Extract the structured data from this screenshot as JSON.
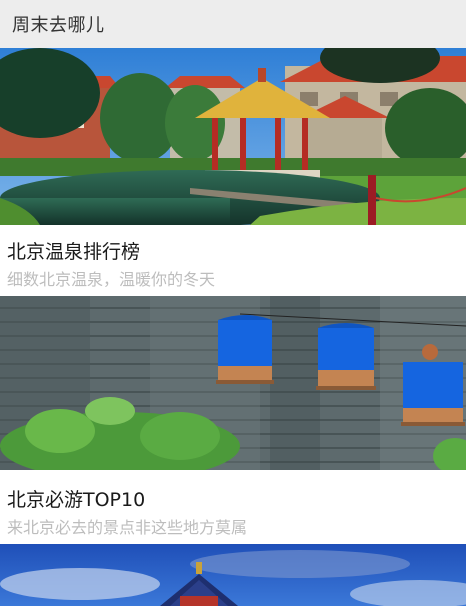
{
  "header": {
    "title": "周末去哪儿"
  },
  "cards": [
    {
      "title": "北京温泉排行榜",
      "subtitle": "细数北京温泉，温暖你的冬天",
      "image_icon": "hot-spring-pavilion-photo"
    },
    {
      "title": "北京必游TOP10",
      "subtitle": "来北京必去的景点非这些地方莫属",
      "image_icon": "birdcage-wall-photo"
    },
    {
      "title": "",
      "subtitle": "",
      "image_icon": "temple-of-heaven-photo"
    }
  ],
  "colors": {
    "header_bg": "#ededed",
    "title": "#1a1a1a",
    "subtitle": "#bdbdbd",
    "sky": "#3b8ad6",
    "cage_blue": "#1565e0"
  }
}
